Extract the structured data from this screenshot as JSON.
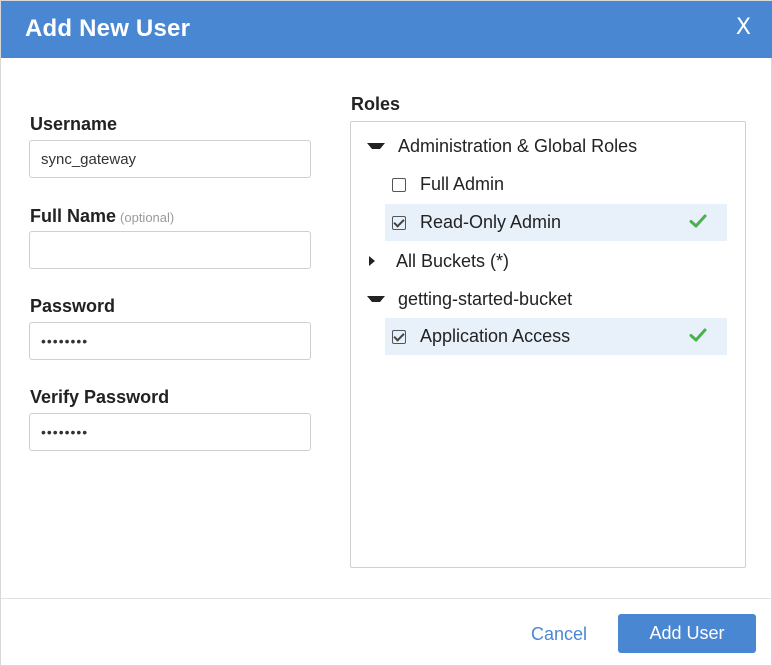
{
  "header": {
    "title": "Add New User",
    "close_label": "X"
  },
  "form": {
    "username": {
      "label": "Username",
      "value": "sync_gateway",
      "placeholder": ""
    },
    "full_name": {
      "label": "Full Name",
      "optional_hint": "(optional)",
      "value": "",
      "placeholder": ""
    },
    "password": {
      "label": "Password",
      "value": "••••••••"
    },
    "verify_password": {
      "label": "Verify Password",
      "value": "••••••••"
    }
  },
  "roles": {
    "label": "Roles",
    "groups": [
      {
        "name": "Administration & Global Roles",
        "expanded": true,
        "items": [
          {
            "label": "Full Admin",
            "checked": false
          },
          {
            "label": "Read-Only Admin",
            "checked": true
          }
        ]
      },
      {
        "name": "All Buckets (*)",
        "expanded": false,
        "items": []
      },
      {
        "name": "getting-started-bucket",
        "expanded": true,
        "items": [
          {
            "label": "Application Access",
            "checked": true
          }
        ]
      }
    ]
  },
  "footer": {
    "cancel_label": "Cancel",
    "submit_label": "Add User"
  },
  "colors": {
    "accent": "#4a87d3",
    "selected_row": "#e8f0fa",
    "check_green": "#4caf50"
  },
  "icons": {
    "expanded": "caret-down-icon",
    "collapsed": "caret-right-icon",
    "selected": "checkmark-icon"
  }
}
